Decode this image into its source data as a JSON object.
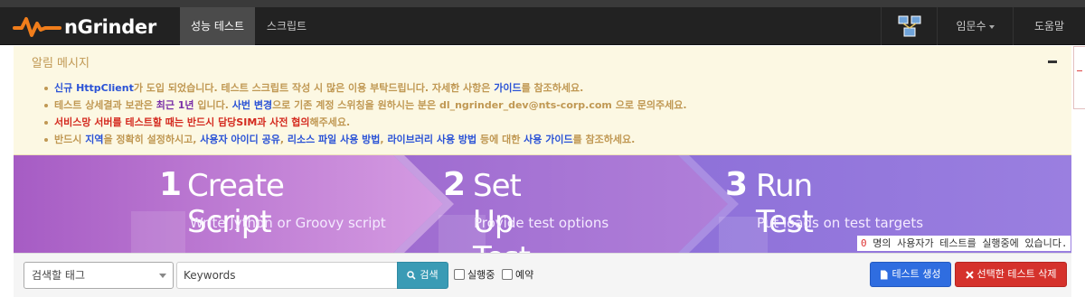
{
  "navbar": {
    "brand": "nGrinder",
    "tabs": [
      {
        "label": "성능 테스트",
        "active": true
      },
      {
        "label": "스크립트",
        "active": false
      }
    ],
    "user_menu": "임문수",
    "help": "도움말"
  },
  "notice": {
    "title": "알림 메시지",
    "lines": [
      {
        "segments": [
          {
            "text": "신규 ",
            "style": "blue"
          },
          {
            "text": "HttpClient",
            "style": "blue"
          },
          {
            "text": "가 도입 되었습니다. 테스트 스크립트 작성 시 많은 이용 부탁드립니다. 자세한 사항은 ",
            "style": "normal"
          },
          {
            "text": "가이드",
            "style": "blue"
          },
          {
            "text": "를 참조하세요.",
            "style": "normal"
          }
        ]
      },
      {
        "segments": [
          {
            "text": "테스트 상세결과 보관은 ",
            "style": "normal"
          },
          {
            "text": "최근 1년",
            "style": "purple"
          },
          {
            "text": " 입니다. ",
            "style": "normal"
          },
          {
            "text": "사번 변경",
            "style": "blue"
          },
          {
            "text": "으로 기존 계정 스위칭을 원하시는 분은 dl_ngrinder_dev@nts-corp.com 으로 문의주세요.",
            "style": "normal"
          }
        ]
      },
      {
        "segments": [
          {
            "text": "서비스망 서버를 테스트할 때는 반드시 담당SIM과 사전 협의",
            "style": "darkred"
          },
          {
            "text": "해주세요.",
            "style": "normal"
          }
        ]
      },
      {
        "segments": [
          {
            "text": "반드시 ",
            "style": "normal"
          },
          {
            "text": "지역",
            "style": "blue"
          },
          {
            "text": "을 정확히 설정하시고, ",
            "style": "normal"
          },
          {
            "text": "사용자 아이디 공유",
            "style": "blue"
          },
          {
            "text": ", ",
            "style": "normal"
          },
          {
            "text": "리소스 파일 사용 방법",
            "style": "blue"
          },
          {
            "text": ", ",
            "style": "normal"
          },
          {
            "text": "라이브러리 사용 방법",
            "style": "blue"
          },
          {
            "text": " 등에 대한 ",
            "style": "normal"
          },
          {
            "text": "사용 가이드",
            "style": "blue"
          },
          {
            "text": "를 참조하세요.",
            "style": "normal"
          }
        ]
      }
    ]
  },
  "banner": {
    "steps": [
      {
        "num": "1",
        "title": "Create Script",
        "subtitle": "Write Jython or Groovy script"
      },
      {
        "num": "2",
        "title": "Set Up Test",
        "subtitle": "Provide test options"
      },
      {
        "num": "3",
        "title": "Run Test",
        "subtitle": "Put loads on test targets"
      }
    ],
    "running_count": "0",
    "running_text": " 명의 사용자가 테스트를 실행중에 있습니다."
  },
  "toolbar": {
    "tag_placeholder": "검색할 태그",
    "keyword_value": "Keywords",
    "search_label": "검색",
    "running_label": "실행중",
    "scheduled_label": "예약",
    "create_label": "테스트 생성",
    "delete_label": "선택한 테스트 삭제"
  },
  "colors": {
    "navbar_bg": "#222222",
    "notice_bg": "#fcf8e3",
    "notice_text": "#c09853",
    "banner_step1": "#c17ad6",
    "banner_step2": "#9a6ad0",
    "banner_step3": "#8a6cd6",
    "search_button": "#3a9bb5",
    "create_button": "#2f6de0",
    "delete_button": "#d5322c"
  }
}
